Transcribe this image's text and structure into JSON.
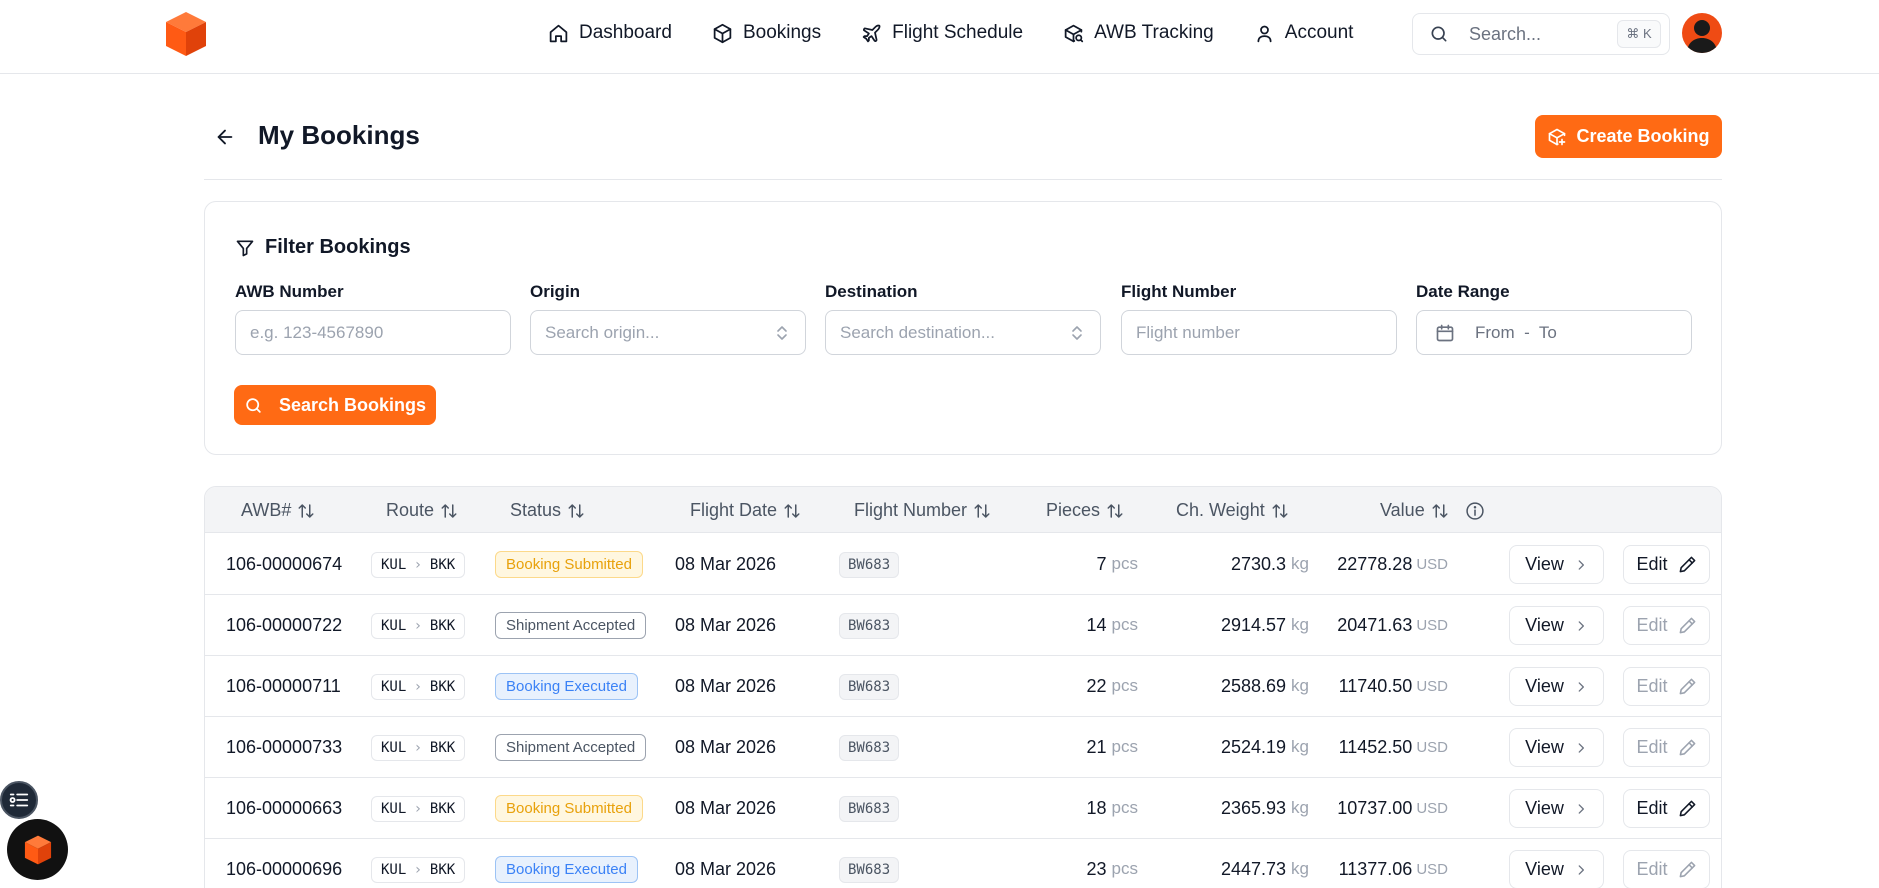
{
  "header": {
    "nav": [
      {
        "label": "Dashboard",
        "icon": "home-icon"
      },
      {
        "label": "Bookings",
        "icon": "box-icon"
      },
      {
        "label": "Flight Schedule",
        "icon": "plane-icon"
      },
      {
        "label": "AWB Tracking",
        "icon": "package-search-icon"
      },
      {
        "label": "Account",
        "icon": "user-icon"
      }
    ],
    "search_placeholder": "Search...",
    "search_shortcut": "⌘ K"
  },
  "page": {
    "title": "My Bookings",
    "create_label": "Create Booking"
  },
  "filters": {
    "title": "Filter Bookings",
    "awb_label": "AWB Number",
    "awb_placeholder": "e.g. 123-4567890",
    "origin_label": "Origin",
    "origin_placeholder": "Search origin...",
    "destination_label": "Destination",
    "destination_placeholder": "Search destination...",
    "flight_label": "Flight Number",
    "flight_placeholder": "Flight number",
    "date_label": "Date Range",
    "date_placeholder": "From  -  To",
    "search_label": "Search Bookings"
  },
  "table": {
    "columns": [
      "AWB#",
      "Route",
      "Status",
      "Flight Date",
      "Flight Number",
      "Pieces",
      "Ch. Weight",
      "Value"
    ],
    "pieces_unit": "pcs",
    "weight_unit": "kg",
    "value_unit": "USD",
    "view_label": "View",
    "edit_label": "Edit",
    "rows": [
      {
        "awb": "106-00000674",
        "origin": "KUL",
        "dest": "BKK",
        "status": "Booking Submitted",
        "status_type": "submitted",
        "date": "08 Mar 2026",
        "flight": "BW683",
        "pieces": "7",
        "weight": "2730.3",
        "value": "22778.28",
        "editable": true
      },
      {
        "awb": "106-00000722",
        "origin": "KUL",
        "dest": "BKK",
        "status": "Shipment Accepted",
        "status_type": "accepted",
        "date": "08 Mar 2026",
        "flight": "BW683",
        "pieces": "14",
        "weight": "2914.57",
        "value": "20471.63",
        "editable": false
      },
      {
        "awb": "106-00000711",
        "origin": "KUL",
        "dest": "BKK",
        "status": "Booking Executed",
        "status_type": "executed",
        "date": "08 Mar 2026",
        "flight": "BW683",
        "pieces": "22",
        "weight": "2588.69",
        "value": "11740.50",
        "editable": false
      },
      {
        "awb": "106-00000733",
        "origin": "KUL",
        "dest": "BKK",
        "status": "Shipment Accepted",
        "status_type": "accepted",
        "date": "08 Mar 2026",
        "flight": "BW683",
        "pieces": "21",
        "weight": "2524.19",
        "value": "11452.50",
        "editable": false
      },
      {
        "awb": "106-00000663",
        "origin": "KUL",
        "dest": "BKK",
        "status": "Booking Submitted",
        "status_type": "submitted",
        "date": "08 Mar 2026",
        "flight": "BW683",
        "pieces": "18",
        "weight": "2365.93",
        "value": "10737.00",
        "editable": true
      },
      {
        "awb": "106-00000696",
        "origin": "KUL",
        "dest": "BKK",
        "status": "Booking Executed",
        "status_type": "executed",
        "date": "08 Mar 2026",
        "flight": "BW683",
        "pieces": "23",
        "weight": "2447.73",
        "value": "11377.06",
        "editable": false
      }
    ]
  },
  "colors": {
    "accent": "#ff6a14",
    "submitted_bg": "#fff7e0",
    "submitted_border": "#fcd98a",
    "submitted_text": "#e8a10b",
    "accepted_bg": "#ffffff",
    "accepted_border": "#9ca3af",
    "accepted_text": "#4b5563",
    "executed_bg": "#e8f1fd",
    "executed_border": "#9cc3f5",
    "executed_text": "#3b82f6"
  }
}
